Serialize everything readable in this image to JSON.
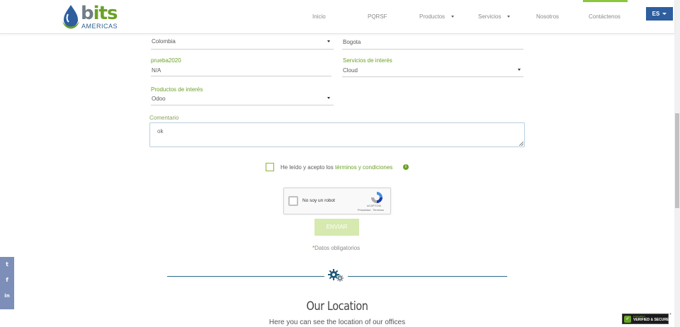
{
  "logo": {
    "text_b": "b",
    "text_its": "its",
    "subtitle": "AMERICAS"
  },
  "nav": {
    "items": [
      {
        "label": "Inicio"
      },
      {
        "label": "PQRSF"
      },
      {
        "label": "Productos"
      },
      {
        "label": "Servicios"
      },
      {
        "label": "Nosotros"
      },
      {
        "label": "Contáctenos"
      }
    ],
    "language": "ES"
  },
  "form": {
    "country": {
      "value": "Colombia"
    },
    "city": {
      "value": "Bogota"
    },
    "company": {
      "label": "prueba2020",
      "value": "N/A"
    },
    "services": {
      "label": "Servicios de interés",
      "value": "Cloud"
    },
    "products": {
      "label": "Productos de interés",
      "value": "Odoo"
    },
    "comment": {
      "label": "Comentario",
      "value": "ok"
    },
    "terms": {
      "prefix": "He leído y acepto los ",
      "link": "términos y condiciones",
      "info_icon": "i"
    },
    "recaptcha": {
      "label": "No soy un robot",
      "brand": "reCAPTCHA",
      "privacy": "Privacidad",
      "separator": " - ",
      "terms": "Términos"
    },
    "submit_label": "ENVIAR",
    "required_note_star": "*",
    "required_note": "Datos obligatorios"
  },
  "location": {
    "title": "Our Location",
    "subtitle": "Here you can see the location of our offices"
  },
  "social": {
    "twitter": "t",
    "facebook": "f",
    "linkedin": "in"
  },
  "badge": {
    "top": "GODADDY",
    "main": "VERIFIED & SECURED",
    "reg": "®",
    "shield": "✓"
  },
  "colors": {
    "accent_green": "#6aa126",
    "brand_blue": "#2e5e9e",
    "social_bg": "#7d8fb8",
    "button_disabled": "#d6e9ae"
  }
}
